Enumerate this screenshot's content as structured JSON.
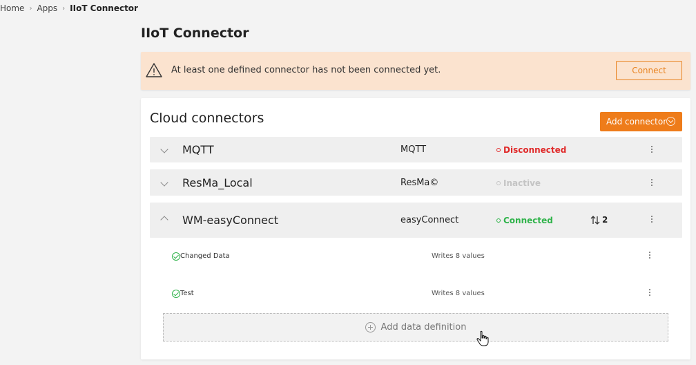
{
  "breadcrumb": {
    "home": "Home",
    "apps": "Apps",
    "current": "IIoT Connector"
  },
  "page": {
    "title": "IIoT Connector"
  },
  "warning": {
    "message": "At least one defined connector has not been connected yet.",
    "connect_label": "Connect"
  },
  "card": {
    "title": "Cloud connectors",
    "add_connector_label": "Add connector",
    "connectors": [
      {
        "name": "MQTT",
        "type": "MQTT",
        "status": "Disconnected",
        "status_color": "#e02a2a",
        "expanded": false
      },
      {
        "name": "ResMa_Local",
        "type": "ResMa©",
        "status": "Inactive",
        "status_color": "#c4c4c4",
        "expanded": false
      },
      {
        "name": "WM-easyConnect",
        "type": "easyConnect",
        "status": "Connected",
        "status_color": "#2fb34a",
        "expanded": true,
        "count": "2"
      }
    ],
    "definitions": [
      {
        "name": "Changed Data",
        "writes": "Writes 8 values"
      },
      {
        "name": "Test",
        "writes": "Writes 8 values"
      }
    ],
    "add_definition_label": "Add data definition"
  },
  "colors": {
    "accent": "#ee7c1a",
    "warning_bg": "#fbe3cf"
  },
  "icons": [
    "warning-triangle-icon",
    "chevron-down-icon",
    "chevron-up-icon",
    "kebab-menu-icon",
    "check-circle-icon",
    "plus-circle-icon",
    "transfer-arrows-icon",
    "hand-cursor-icon"
  ]
}
